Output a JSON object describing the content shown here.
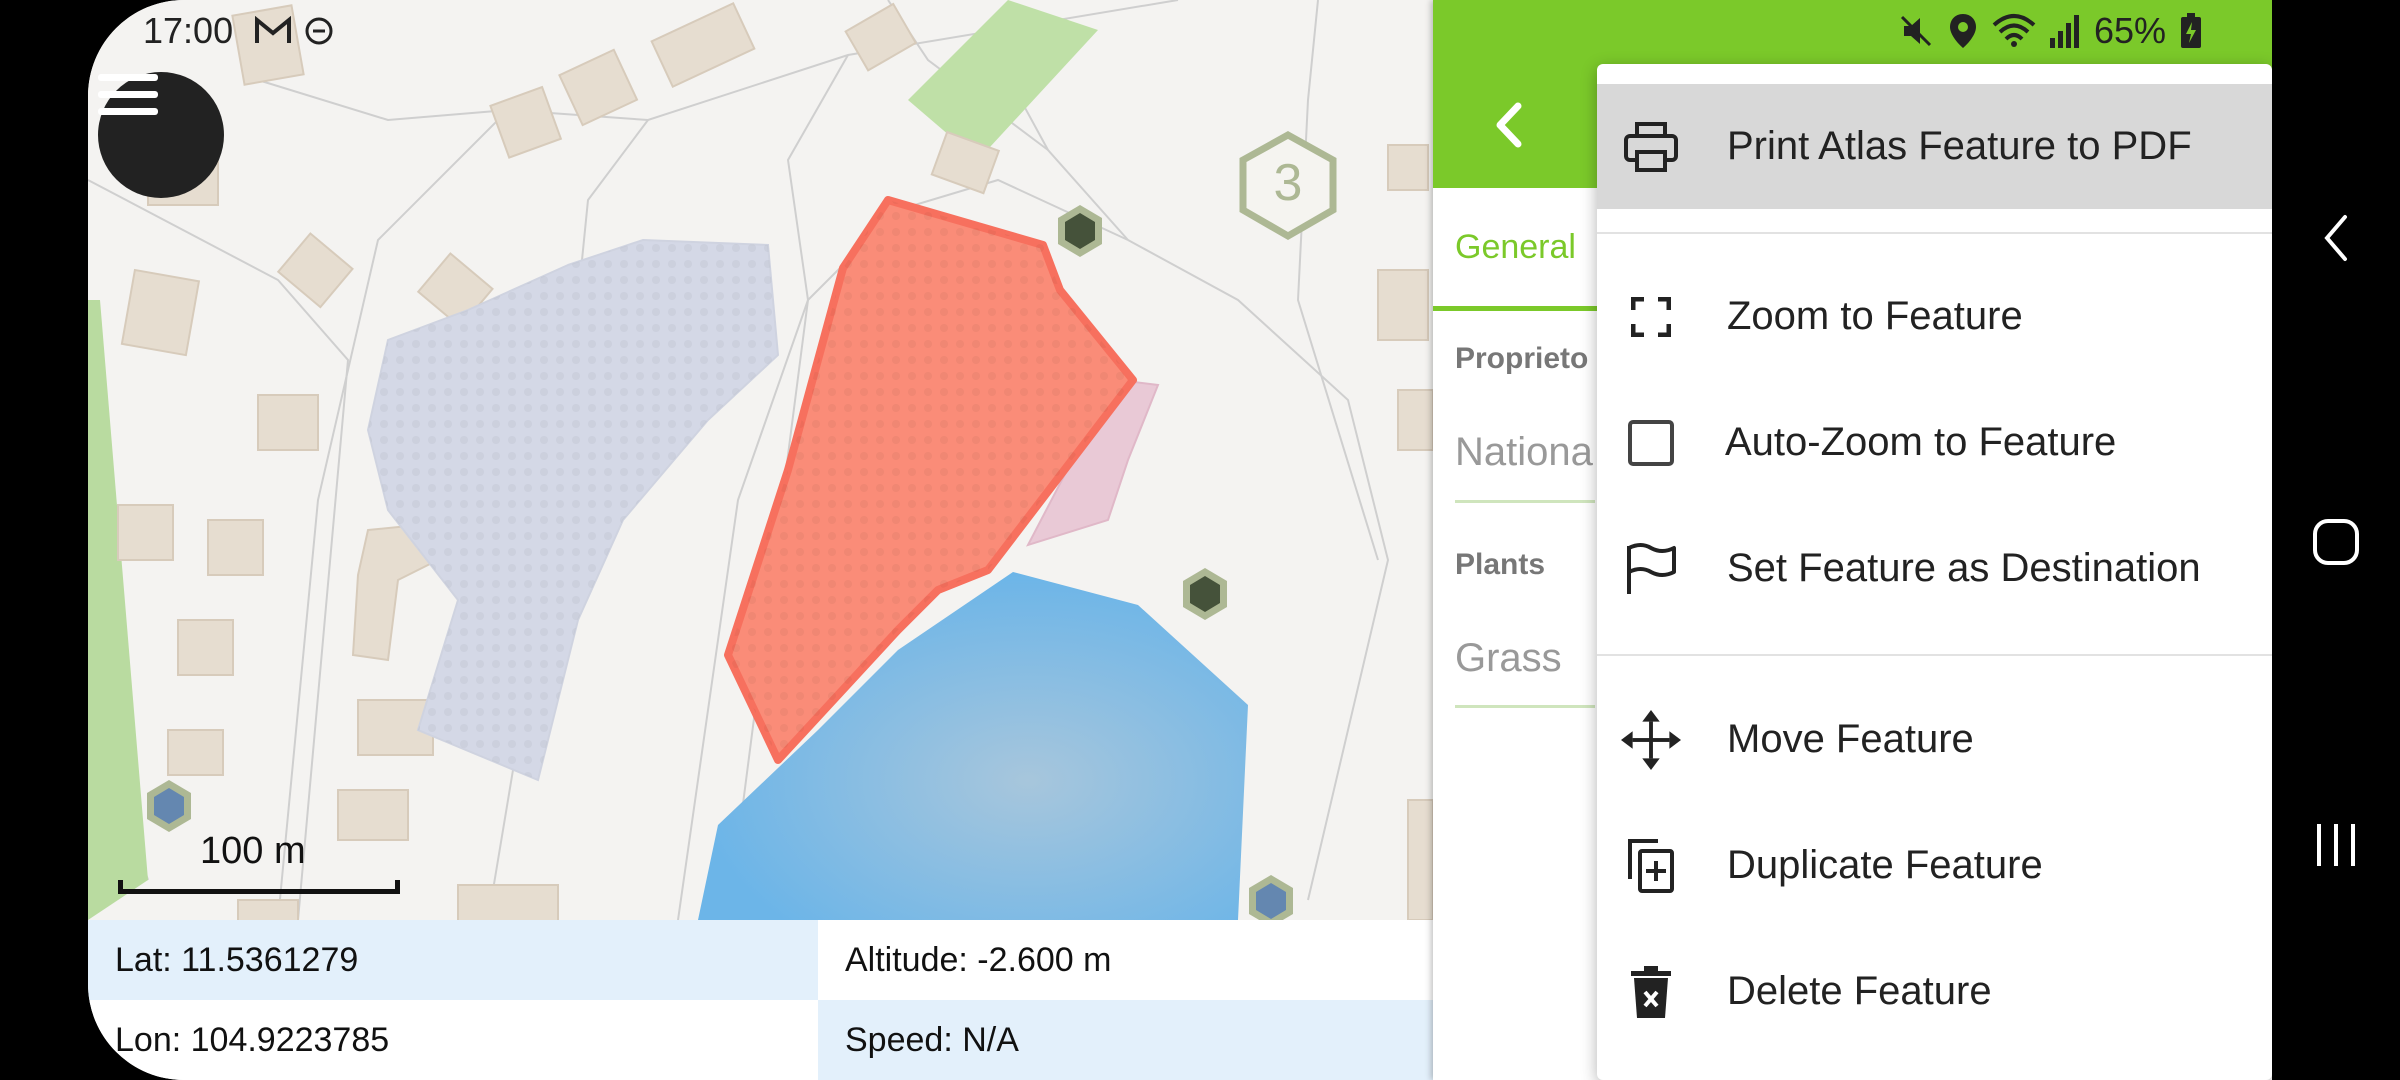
{
  "status_bar": {
    "time": "17:00",
    "battery": "65%"
  },
  "map": {
    "cluster_count": "3",
    "scale_label": "100 m"
  },
  "info": {
    "lat": "Lat: 11.5361279",
    "lon": "Lon: 104.9223785",
    "altitude": "Altitude: -2.600 m",
    "speed": "Speed: N/A"
  },
  "panel": {
    "tab_general": "General",
    "fields": [
      {
        "label": "Proprieto",
        "value": "Nationa"
      },
      {
        "label": "Plants",
        "value": "Grass"
      }
    ]
  },
  "popup_menu": {
    "items": [
      {
        "label": "Print Atlas Feature to PDF",
        "icon": "printer-icon"
      },
      {
        "label": "Zoom to Feature",
        "icon": "zoom-extent-icon"
      },
      {
        "label": "Auto-Zoom to Feature",
        "icon": "checkbox-icon"
      },
      {
        "label": "Set Feature as Destination",
        "icon": "flag-icon"
      },
      {
        "label": "Move Feature",
        "icon": "move-icon"
      },
      {
        "label": "Duplicate Feature",
        "icon": "duplicate-icon"
      },
      {
        "label": "Delete Feature",
        "icon": "trash-icon"
      }
    ]
  },
  "colors": {
    "accent": "#7bc92a",
    "selected_polygon": "#fa8c78",
    "water": "#7ab8e6"
  }
}
